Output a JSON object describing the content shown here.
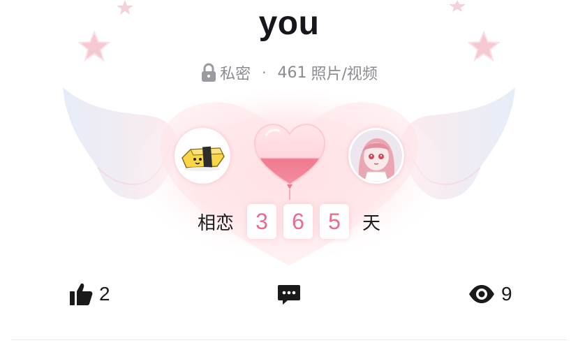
{
  "album": {
    "title": "you",
    "privacy_label": "私密",
    "separator": "·",
    "media_count": "461",
    "media_label": "照片/视频"
  },
  "anniversary": {
    "prefix": "相恋",
    "digits": [
      "3",
      "6",
      "5"
    ],
    "suffix": "天"
  },
  "actions": {
    "likes": "2",
    "views": "9"
  },
  "icons": {
    "lock": "lock-icon",
    "like": "thumbs-up-icon",
    "comment": "chat-bubble-icon",
    "view": "eye-icon"
  },
  "colors": {
    "accent_pink": "#ec6a8a",
    "heart_fill": "#f07a90",
    "meta_gray": "#8b8b90"
  }
}
